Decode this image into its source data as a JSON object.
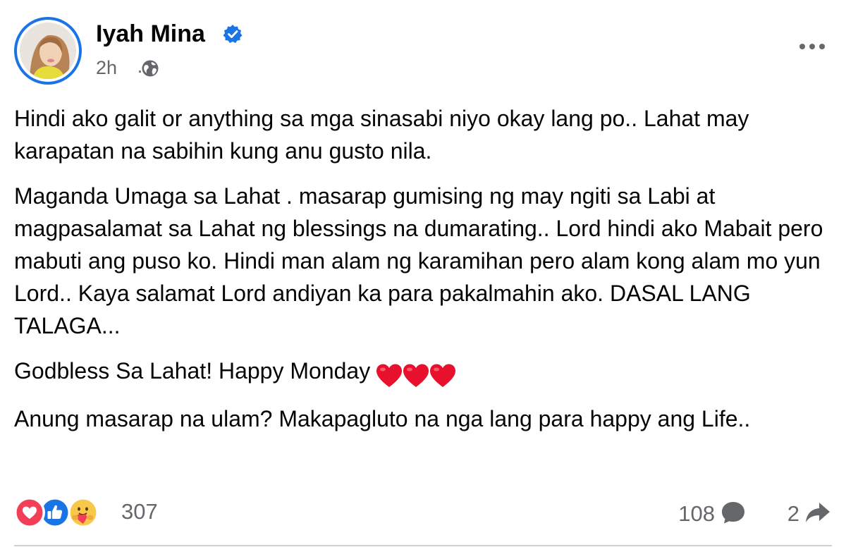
{
  "post": {
    "author": "Iyah Mina",
    "verified": true,
    "time": "2h",
    "privacy_icon": "globe-icon",
    "more_icon": "more-options-icon",
    "paragraphs": [
      "Hindi ako galit or anything sa mga sinasabi niyo okay lang po.. Lahat may karapatan na sabihin kung anu gusto nila.",
      "Maganda Umaga sa Lahat . masarap gumising ng may ngiti sa Labi at magpasalamat sa Lahat ng blessings na dumarating.. Lord hindi ako Mabait pero mabuti ang puso ko. Hindi man alam ng karamihan pero alam kong alam mo yun Lord.. Kaya salamat Lord andiyan ka para pakalmahin ako. DASAL LANG TALAGA...",
      "Godbless Sa Lahat! Happy Monday",
      "Anung masarap na ulam? Makapagluto na nga lang para happy ang Life.."
    ],
    "heart_emoji_count": 3
  },
  "footer": {
    "reaction_icons": [
      "love-reaction-icon",
      "like-reaction-icon",
      "care-reaction-icon"
    ],
    "reaction_count": "307",
    "comment_count": "108",
    "share_count": "2"
  },
  "colors": {
    "accent": "#1b74e4",
    "text": "#050505",
    "secondary_text": "#65676b",
    "love": "#f33e58",
    "heart_emoji": "#e8112d"
  }
}
